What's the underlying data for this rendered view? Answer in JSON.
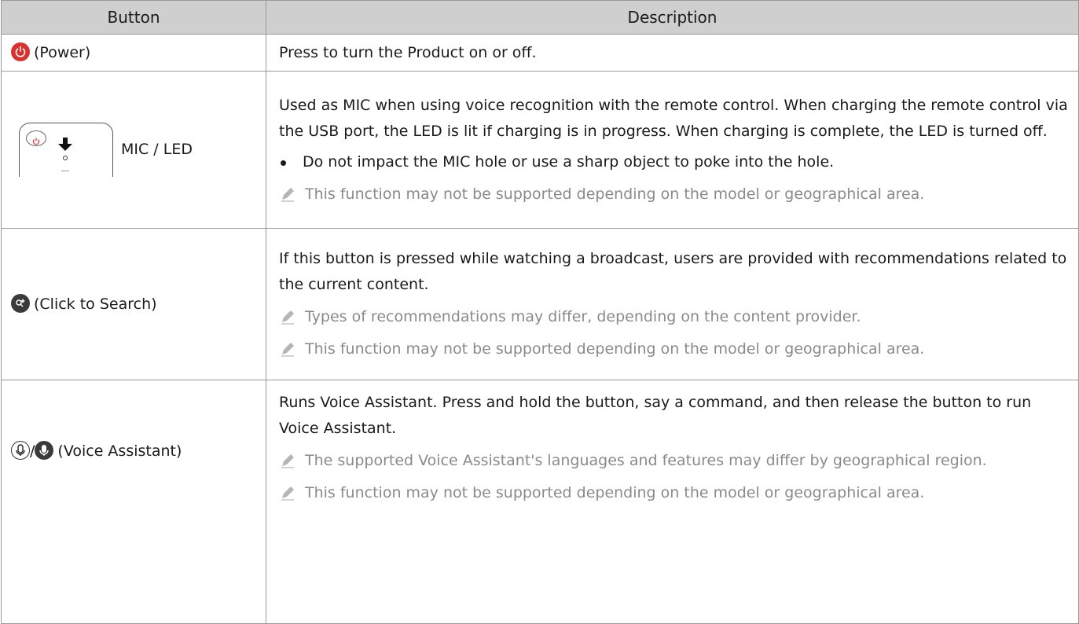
{
  "header": {
    "button": "Button",
    "description": "Description"
  },
  "rows": [
    {
      "button_label": "(Power)",
      "icon": "power-icon",
      "paragraphs": [
        "Press to turn the Product on or off."
      ]
    },
    {
      "button_label": "MIC / LED",
      "icon": "remote-mic-led-illustration",
      "paragraphs": [
        "Used as MIC when using voice recognition with the remote control. When charging the remote control via the USB port, the LED is lit if charging is in progress. When charging is complete, the LED is turned off."
      ],
      "bullet": "Do not impact the MIC hole or use a sharp object to poke into the hole.",
      "notes": [
        "This function may not be supported depending on the model or geographical area."
      ]
    },
    {
      "button_label": "(Click to Search)",
      "icon": "click-to-search-icon",
      "paragraphs": [
        "If this button is pressed while watching a broadcast, users are provided with recommendations related to the current content."
      ],
      "notes": [
        "Types of recommendations may differ, depending on the content provider.",
        "This function may not be supported depending on the model or geographical area."
      ]
    },
    {
      "button_label": "(Voice Assistant)",
      "icon_separator": "/",
      "icon": "microphone-icon",
      "paragraphs": [
        "Runs Voice Assistant. Press and hold the button, say a command, and then release the button to run Voice Assistant."
      ],
      "notes": [
        "The supported Voice Assistant's languages and features may differ by geographical region.",
        "This function may not be supported depending on the model or geographical area."
      ]
    }
  ],
  "colors": {
    "header_bg": "#cfcfcf",
    "power": "#d9322e",
    "note_text": "#8a8a8a"
  }
}
